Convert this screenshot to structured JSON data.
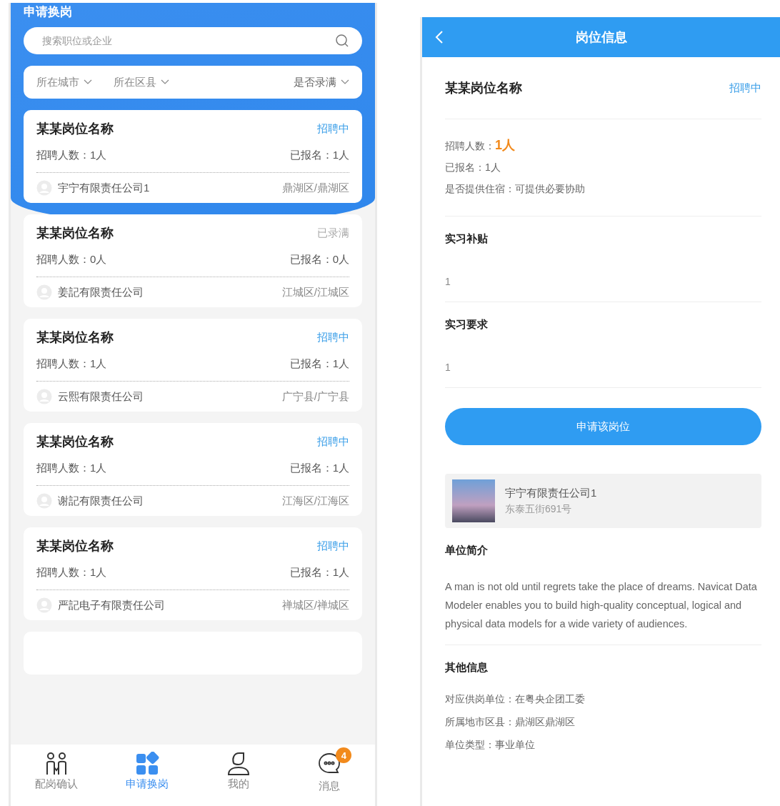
{
  "list_screen": {
    "title": "申请换岗",
    "search": {
      "placeholder": "搜索职位或企业"
    },
    "filters": [
      {
        "label": "所在城市"
      },
      {
        "label": "所在区县"
      },
      {
        "label": "是否录满"
      }
    ],
    "jobs": [
      {
        "title": "某某岗位名称",
        "status": "招聘中",
        "full": false,
        "openings": "招聘人数：1人",
        "applied": "已报名：1人",
        "company": "宇宁有限责任公司1",
        "district": "鼎湖区/鼎湖区"
      },
      {
        "title": "某某岗位名称",
        "status": "已录满",
        "full": true,
        "openings": "招聘人数：0人",
        "applied": "已报名：0人",
        "company": "姜記有限责任公司",
        "district": "江城区/江城区"
      },
      {
        "title": "某某岗位名称",
        "status": "招聘中",
        "full": false,
        "openings": "招聘人数：1人",
        "applied": "已报名：1人",
        "company": "云熙有限责任公司",
        "district": "广宁县/广宁县"
      },
      {
        "title": "某某岗位名称",
        "status": "招聘中",
        "full": false,
        "openings": "招聘人数：1人",
        "applied": "已报名：1人",
        "company": "谢記有限责任公司",
        "district": "江海区/江海区"
      },
      {
        "title": "某某岗位名称",
        "status": "招聘中",
        "full": false,
        "openings": "招聘人数：1人",
        "applied": "已报名：1人",
        "company": "严記电子有限责任公司",
        "district": "禅城区/禅城区"
      }
    ],
    "tab_bar": [
      {
        "kind": "pair",
        "label": "配岗确认",
        "selected": false
      },
      {
        "kind": "grid",
        "label": "申请换岗",
        "selected": true
      },
      {
        "kind": "person",
        "label": "我的",
        "selected": false
      },
      {
        "kind": "chat",
        "label": "消息",
        "selected": false,
        "badge": "4"
      }
    ]
  },
  "detail_screen": {
    "title": "岗位信息",
    "job_title": "某某岗位名称",
    "status": "招聘中",
    "openings_label": "招聘人数：",
    "openings_value": "1人",
    "applied": "已报名：1人",
    "housing": "是否提供住宿：可提供必要协助",
    "sections": [
      {
        "heading": "实习补贴",
        "body": "1"
      },
      {
        "heading": "实习要求",
        "body": "1"
      }
    ],
    "apply_button": "申请该岗位",
    "company": {
      "name": "宇宁有限责任公司1",
      "address": "东泰五街691号"
    },
    "intro": {
      "heading": "单位简介",
      "body": "A man is not old until regrets take the place of dreams. Navicat Data Modeler enables you to build high-quality conceptual, logical and physical data models for a wide variety of audiences."
    },
    "other": {
      "heading": "其他信息",
      "lines": [
        "对应供岗单位：在粤央企团工委",
        "所属地市区县：鼎湖区鼎湖区",
        "单位类型：事业单位"
      ]
    }
  }
}
